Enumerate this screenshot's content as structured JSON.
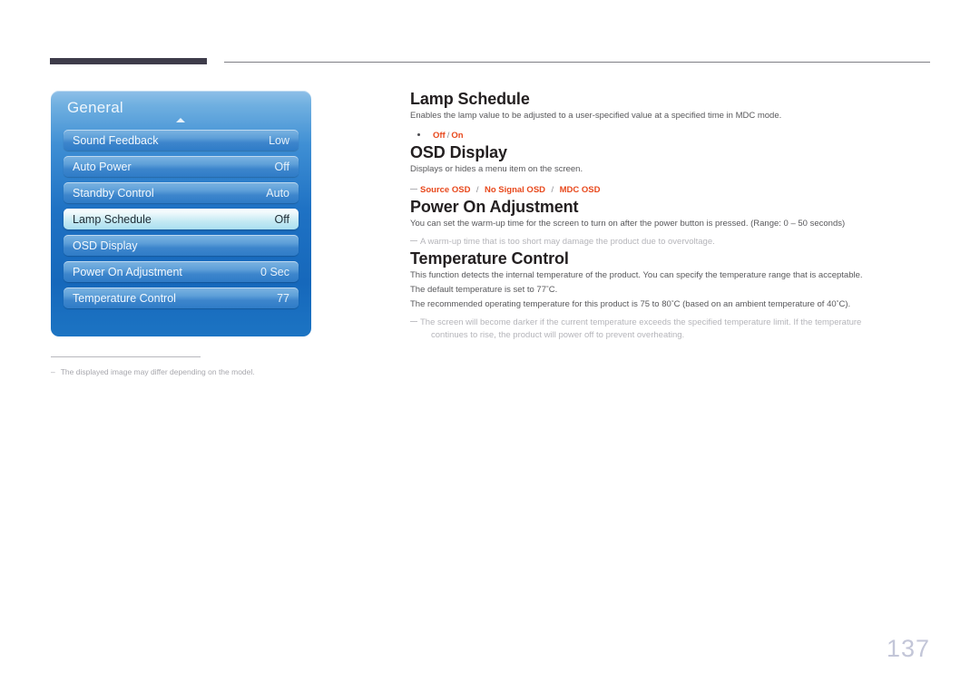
{
  "header": {
    "thick_rule": "",
    "thin_rule": ""
  },
  "osd": {
    "title": "General",
    "rows": [
      {
        "label": "Sound Feedback",
        "value": "Low",
        "selected": false
      },
      {
        "label": "Auto Power",
        "value": "Off",
        "selected": false
      },
      {
        "label": "Standby Control",
        "value": "Auto",
        "selected": false
      },
      {
        "label": "Lamp Schedule",
        "value": "Off",
        "selected": true
      },
      {
        "label": "OSD Display",
        "value": "",
        "selected": false
      },
      {
        "label": "Power On Adjustment",
        "value": "0 Sec",
        "selected": false
      },
      {
        "label": "Temperature Control",
        "value": "77",
        "selected": false
      }
    ]
  },
  "left_note": {
    "dash": "–",
    "text": "The displayed image may differ depending on the model."
  },
  "sections": [
    {
      "title": "Lamp Schedule",
      "body": "Enables the lamp value to be adjusted to a user-specified value at a specified time in MDC mode.",
      "bullet_options": [
        "Off",
        "On"
      ],
      "bullet_separator": "/"
    },
    {
      "title": "OSD Display",
      "body": "Displays or hides a menu item on the screen.",
      "dash_options": [
        "Source OSD",
        "No Signal OSD",
        "MDC OSD"
      ],
      "dash_separator": "/"
    },
    {
      "title": "Power On Adjustment",
      "body": "You can set the warm-up time for the screen to turn on after the power button is pressed. (Range: 0 – 50 seconds)",
      "note": "A warm-up time that is too short may damage the product due to overvoltage."
    },
    {
      "title": "Temperature Control",
      "body1": "This function detects the internal temperature of the product. You can specify the temperature range that is acceptable.",
      "body2_pre": "The default temperature is set to 77",
      "body2_post": "C.",
      "body3_pre": "The recommended operating temperature for this product is 75 to 80",
      "body3_mid": "C (based on an ambient temperature of 40",
      "body3_post": "C).",
      "degree": "°",
      "note_line1": "The screen will become darker if the current temperature exceeds the specified temperature limit. If the temperature",
      "note_line2": "continues to rise, the product will power off to prevent overheating."
    }
  ],
  "page_number": "137",
  "colors": {
    "accent_orange": "#e8491d",
    "panel_blue": "#1f72c4",
    "heading": "#231f20",
    "body_text": "#58585b",
    "muted": "#b5b5ba",
    "page_number": "#c3c6d8",
    "header_bar": "#3e3c4a"
  }
}
